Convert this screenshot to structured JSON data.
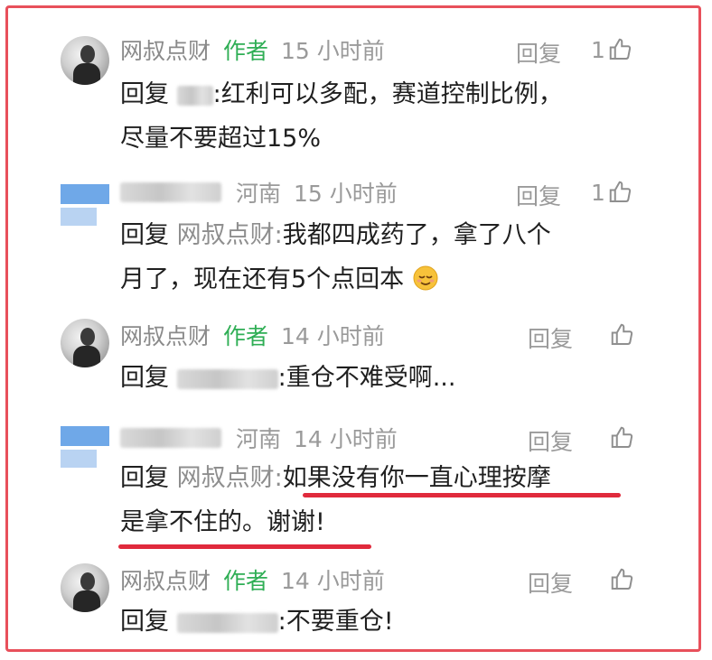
{
  "reply_prefix": "回复",
  "colon": ":",
  "comments": [
    {
      "name": "网叔点财",
      "author_tag": "作者",
      "time": "15 小时前",
      "reply_label": "回复",
      "likes": "1",
      "line1": "红利可以多配，赛道控制比例，",
      "line2": "尽量不要超过15%"
    },
    {
      "location": "河南",
      "time": "15 小时前",
      "reply_label": "回复",
      "likes": "1",
      "reply_to": "网叔点财",
      "line1": "我都四成药了，拿了八个",
      "line2": "月了，现在还有5个点回本"
    },
    {
      "name": "网叔点财",
      "author_tag": "作者",
      "time": "14 小时前",
      "reply_label": "回复",
      "line1": "重仓不难受啊..."
    },
    {
      "location": "河南",
      "time": "14 小时前",
      "reply_label": "回复",
      "reply_to": "网叔点财",
      "line1": "如果没有你一直心理按摩",
      "line2": "是拿不住的。谢谢!"
    },
    {
      "name": "网叔点财",
      "author_tag": "作者",
      "time": "14 小时前",
      "reply_label": "回复",
      "line1": "不要重仓!"
    }
  ],
  "colors": {
    "author_green": "#2fae55",
    "highlight_red": "#e02a3c",
    "frame_red": "#e8505b"
  },
  "icons": {
    "like": "thumbs-up-icon",
    "emoji": "relieved-face-emoji"
  }
}
